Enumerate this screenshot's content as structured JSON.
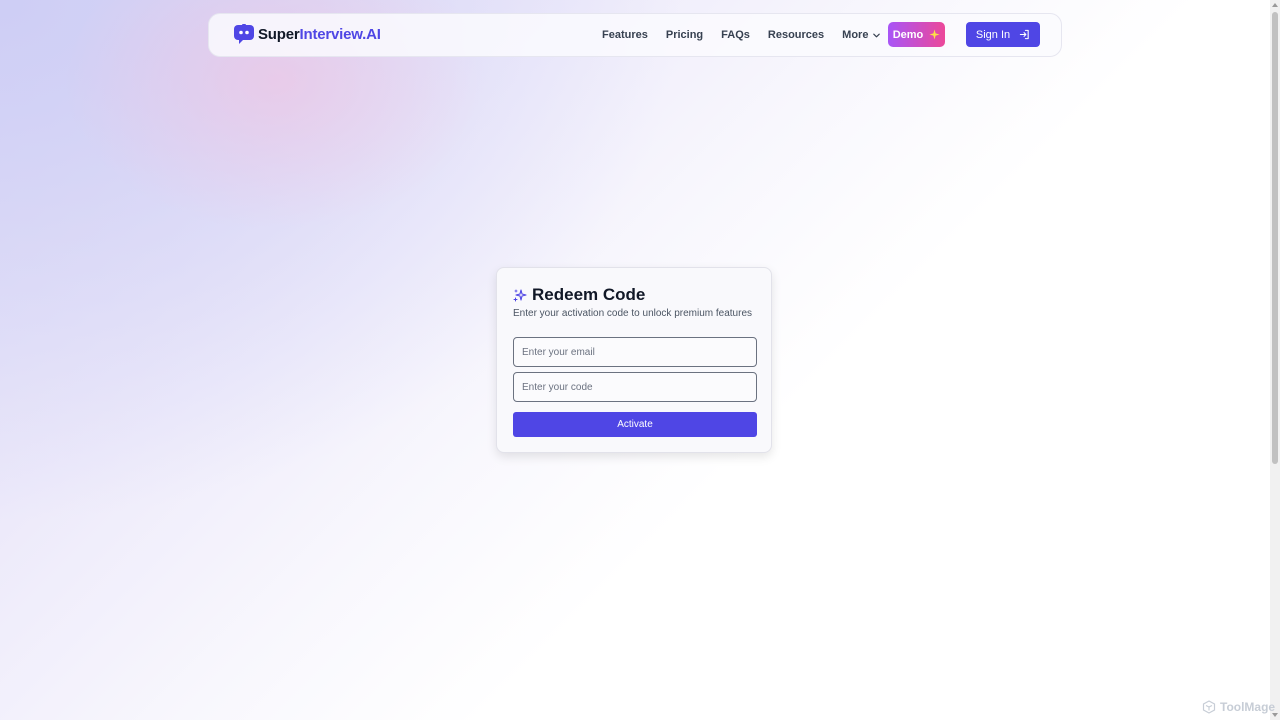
{
  "brand": {
    "name_bold": "Super",
    "name_accent": "Interview.AI",
    "accent_color": "#4f46e5"
  },
  "nav": {
    "links": [
      {
        "label": "Features"
      },
      {
        "label": "Pricing"
      },
      {
        "label": "FAQs"
      },
      {
        "label": "Resources"
      },
      {
        "label": "More",
        "icon": "chevron-down-icon"
      }
    ],
    "demo_label": "Demo",
    "demo_icon": "sparkle-icon",
    "signin_label": "Sign In",
    "signin_icon": "login-icon"
  },
  "card": {
    "icon": "sparkles-icon",
    "title": "Redeem Code",
    "subtitle": "Enter your activation code to unlock premium features",
    "email_placeholder": "Enter your email",
    "email_value": "",
    "code_placeholder": "Enter your code",
    "code_value": "",
    "button_label": "Activate"
  },
  "watermark": {
    "text": "ToolMage",
    "icon": "toolmage-logo-icon"
  },
  "colors": {
    "primary": "#4f46e5",
    "demo_gradient_start": "#a855f7",
    "demo_gradient_end": "#ec4899"
  }
}
